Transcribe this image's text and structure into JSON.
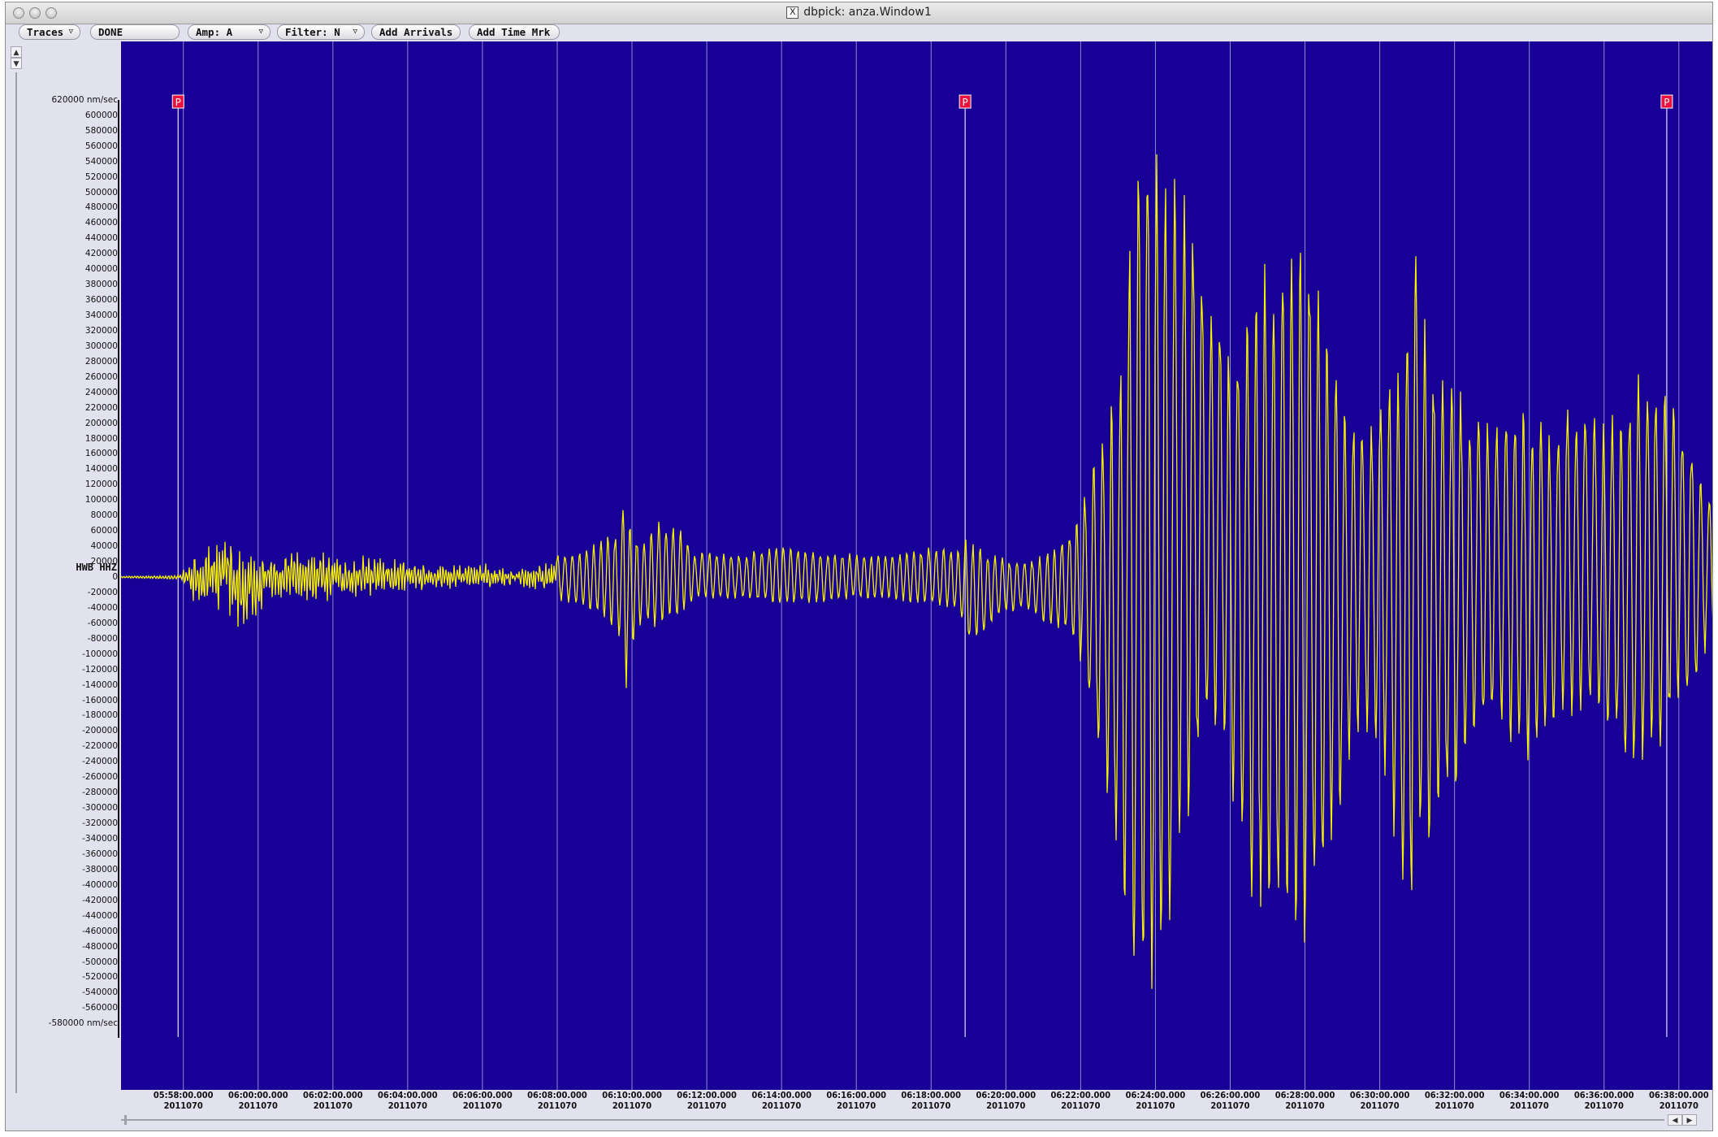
{
  "window": {
    "title": "dbpick: anza.Window1",
    "title_icon": "x11-icon"
  },
  "toolbar": {
    "buttons": [
      {
        "label": "Traces",
        "has_menu": true
      },
      {
        "label": "DONE",
        "has_menu": false
      },
      {
        "label": "Amp: A",
        "has_menu": true
      },
      {
        "label": "Filter: N",
        "has_menu": true
      },
      {
        "label": "Add Arrivals",
        "has_menu": false
      },
      {
        "label": "Add Time Mrk",
        "has_menu": false
      }
    ]
  },
  "colors": {
    "plot_background": "#180096",
    "trace": "#f5f000",
    "gridline": "#8c8cd0",
    "pick_flag": "#e8123c",
    "pick_line": "#e0e0ff"
  },
  "trace": {
    "station": "HWB HHZ",
    "units": "nm/sec",
    "y_top_label": "620000 nm/sec",
    "y_bottom_label": "-580000 nm/sec"
  },
  "picks": [
    {
      "label": "P",
      "time": "05:57:49"
    },
    {
      "label": "P",
      "time": "06:18:52"
    },
    {
      "label": "P",
      "time": "06:37:38"
    }
  ],
  "chart_data": {
    "type": "line",
    "xlabel": "",
    "ylabel": "",
    "xlim": [
      "05:56:20",
      "06:38:55"
    ],
    "ylim": [
      -600000,
      640000
    ],
    "y_ticks": [
      620000,
      600000,
      580000,
      560000,
      540000,
      520000,
      500000,
      480000,
      460000,
      440000,
      420000,
      400000,
      380000,
      360000,
      340000,
      320000,
      300000,
      280000,
      260000,
      240000,
      220000,
      200000,
      180000,
      160000,
      140000,
      120000,
      100000,
      80000,
      60000,
      40000,
      20000,
      0,
      -20000,
      -40000,
      -60000,
      -80000,
      -100000,
      -120000,
      -140000,
      -160000,
      -180000,
      -200000,
      -220000,
      -240000,
      -260000,
      -280000,
      -300000,
      -320000,
      -340000,
      -360000,
      -380000,
      -400000,
      -420000,
      -440000,
      -460000,
      -480000,
      -500000,
      -520000,
      -540000,
      -560000,
      -580000
    ],
    "x_ticks": [
      {
        "time": "05:58:00.000",
        "date": "2011070"
      },
      {
        "time": "06:00:00.000",
        "date": "2011070"
      },
      {
        "time": "06:02:00.000",
        "date": "2011070"
      },
      {
        "time": "06:04:00.000",
        "date": "2011070"
      },
      {
        "time": "06:06:00.000",
        "date": "2011070"
      },
      {
        "time": "06:08:00.000",
        "date": "2011070"
      },
      {
        "time": "06:10:00.000",
        "date": "2011070"
      },
      {
        "time": "06:12:00.000",
        "date": "2011070"
      },
      {
        "time": "06:14:00.000",
        "date": "2011070"
      },
      {
        "time": "06:16:00.000",
        "date": "2011070"
      },
      {
        "time": "06:18:00.000",
        "date": "2011070"
      },
      {
        "time": "06:20:00.000",
        "date": "2011070"
      },
      {
        "time": "06:22:00.000",
        "date": "2011070"
      },
      {
        "time": "06:24:00.000",
        "date": "2011070"
      },
      {
        "time": "06:26:00.000",
        "date": "2011070"
      },
      {
        "time": "06:28:00.000",
        "date": "2011070"
      },
      {
        "time": "06:30:00.000",
        "date": "2011070"
      },
      {
        "time": "06:32:00.000",
        "date": "2011070"
      },
      {
        "time": "06:34:00.000",
        "date": "2011070"
      },
      {
        "time": "06:36:00.000",
        "date": "2011070"
      },
      {
        "time": "06:38:00.000",
        "date": "2011070"
      }
    ],
    "grid": true,
    "series": [
      {
        "times": [
          "05:56:20",
          "05:57:50",
          "05:58:20",
          "05:58:50",
          "05:59:10",
          "05:59:30",
          "05:59:55",
          "06:00:20",
          "06:01:00",
          "06:02:00",
          "06:03:00",
          "06:04:00",
          "06:05:00",
          "06:06:00",
          "06:07:00",
          "06:08:00",
          "06:08:40",
          "06:09:20",
          "06:09:40",
          "06:09:50",
          "06:10:00",
          "06:10:20",
          "06:10:40",
          "06:11:00",
          "06:11:20",
          "06:11:40",
          "06:12:00",
          "06:13:00",
          "06:14:00",
          "06:15:00",
          "06:16:00",
          "06:17:00",
          "06:18:00",
          "06:18:40",
          "06:19:00",
          "06:19:20",
          "06:19:40",
          "06:20:00",
          "06:20:30",
          "06:21:00",
          "06:21:40",
          "06:22:00",
          "06:22:30",
          "06:23:00",
          "06:23:20",
          "06:23:40",
          "06:24:00",
          "06:24:20",
          "06:24:40",
          "06:25:00",
          "06:25:20",
          "06:25:40",
          "06:26:00",
          "06:26:30",
          "06:27:00",
          "06:27:30",
          "06:28:00",
          "06:28:30",
          "06:29:00",
          "06:29:30",
          "06:30:00",
          "06:30:20",
          "06:30:40",
          "06:31:00",
          "06:31:30",
          "06:32:00",
          "06:32:30",
          "06:33:00",
          "06:33:30",
          "06:34:00",
          "06:34:30",
          "06:35:00",
          "06:35:30",
          "06:36:00",
          "06:36:30",
          "06:37:00",
          "06:37:30",
          "06:38:00",
          "06:38:30",
          "06:38:55"
        ],
        "envelope_upper": [
          1000,
          2000,
          40000,
          50000,
          70000,
          45000,
          45000,
          45000,
          40000,
          35000,
          32000,
          25000,
          20000,
          20000,
          15000,
          30000,
          35000,
          55000,
          60000,
          120000,
          60000,
          50000,
          80000,
          70000,
          60000,
          30000,
          35000,
          30000,
          45000,
          35000,
          30000,
          30000,
          40000,
          40000,
          55000,
          40000,
          30000,
          25000,
          20000,
          30000,
          60000,
          100000,
          190000,
          250000,
          480000,
          620000,
          600000,
          550000,
          520000,
          480000,
          400000,
          350000,
          320000,
          350000,
          420000,
          440000,
          480000,
          360000,
          250000,
          200000,
          240000,
          280000,
          340000,
          430000,
          280000,
          260000,
          220000,
          210000,
          250000,
          220000,
          200000,
          230000,
          240000,
          220000,
          210000,
          280000,
          260000,
          220000,
          160000,
          100000
        ],
        "envelope_lower": [
          -1000,
          -3000,
          -40000,
          -50000,
          -60000,
          -100000,
          -60000,
          -50000,
          -40000,
          -35000,
          -30000,
          -25000,
          -20000,
          -20000,
          -15000,
          -30000,
          -40000,
          -60000,
          -80000,
          -150000,
          -90000,
          -60000,
          -70000,
          -60000,
          -50000,
          -30000,
          -30000,
          -30000,
          -40000,
          -35000,
          -30000,
          -30000,
          -40000,
          -45000,
          -90000,
          -80000,
          -60000,
          -50000,
          -40000,
          -60000,
          -80000,
          -120000,
          -240000,
          -380000,
          -520000,
          -570000,
          -600000,
          -540000,
          -420000,
          -300000,
          -240000,
          -200000,
          -300000,
          -420000,
          -460000,
          -480000,
          -490000,
          -400000,
          -300000,
          -200000,
          -220000,
          -330000,
          -480000,
          -420000,
          -330000,
          -280000,
          -220000,
          -200000,
          -220000,
          -240000,
          -230000,
          -200000,
          -190000,
          -200000,
          -240000,
          -260000,
          -230000,
          -180000,
          -140000,
          -80000
        ]
      }
    ]
  }
}
